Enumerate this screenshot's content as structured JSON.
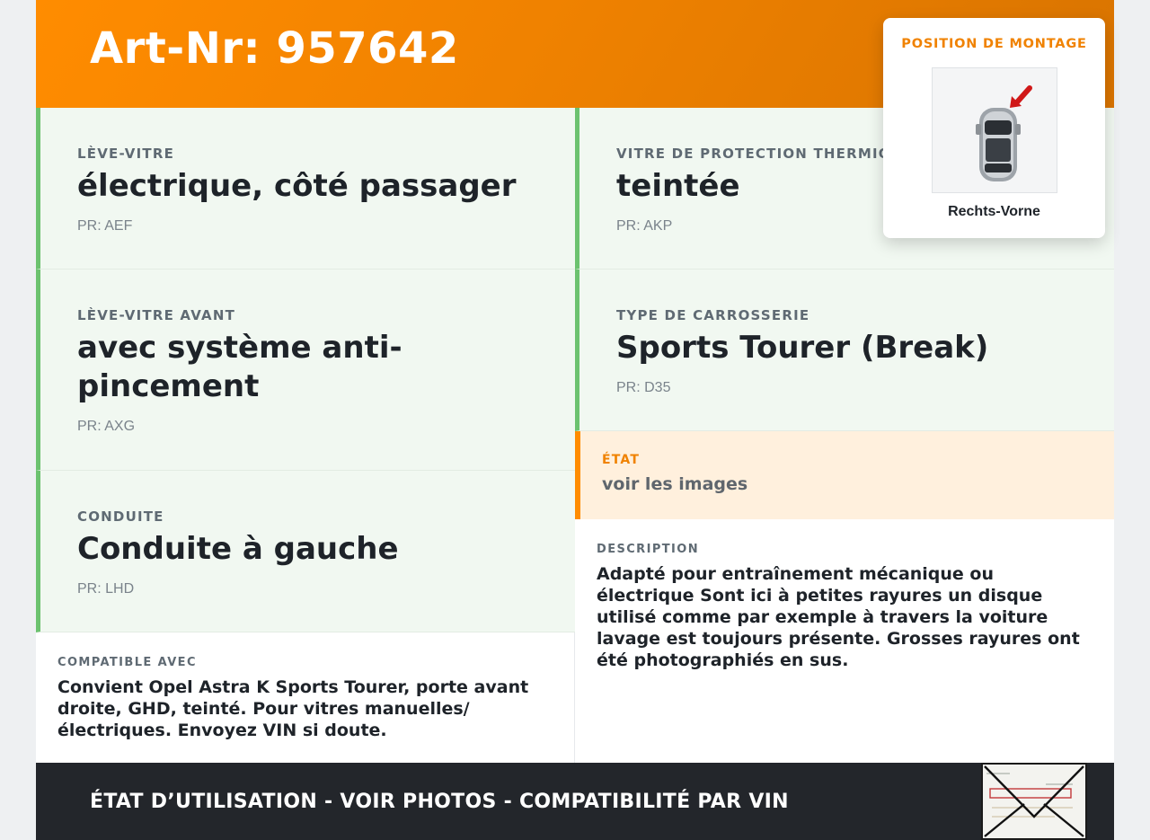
{
  "header": {
    "title": "Art-Nr: 957642"
  },
  "specs": {
    "lift": {
      "label": "LÈVE-VITRE",
      "value": "électrique, côté passager",
      "code": "PR: AEF"
    },
    "lift_front": {
      "label": "LÈVE-VITRE AVANT",
      "value": "avec système anti-pincement",
      "code": "PR: AXG"
    },
    "drive": {
      "label": "CONDUITE",
      "value": "Conduite à gauche",
      "code": "PR: LHD"
    },
    "glass": {
      "label": "VITRE DE PROTECTION THERMIQUE",
      "value": "teintée",
      "code": "PR: AKP"
    },
    "body": {
      "label": "TYPE DE CARROSSERIE",
      "value": "Sports Tourer (Break)",
      "code": "PR: D35"
    }
  },
  "condition": {
    "label": "ÉTAT",
    "value": "voir les images"
  },
  "description": {
    "label": "DESCRIPTION",
    "text": "Adapté pour entraînement mécanique ou électrique Sont ici à petites rayures un disque utilisé comme par exemple à travers la voiture lavage est toujours présente. Grosses rayures ont été photographiés en sus."
  },
  "compatibility": {
    "label": "COMPATIBLE AVEC",
    "text": "Convient Opel Astra K Sports Tourer, porte avant droite, GHD, teinté. Pour vitres manuelles/électriques. Envoyez VIN si doute."
  },
  "mounting": {
    "label": "POSITION DE MONTAGE",
    "position": "Rechts-Vorne",
    "icon": "car-top-view-icon"
  },
  "footer": {
    "text": "ÉTAT D’UTILISATION - VOIR PHOTOS - COMPATIBILITÉ PAR VIN",
    "stamp": "registration-document-thumbnail"
  },
  "colors": {
    "accent": "#ff8c00",
    "green": "#6cc26f",
    "footer": "#23262b"
  }
}
